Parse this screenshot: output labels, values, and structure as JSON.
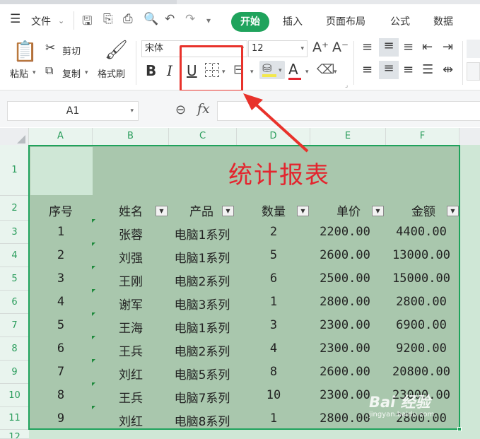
{
  "menubar": {
    "file_label": "文件",
    "kaishi_label": "开始",
    "tabs": [
      "插入",
      "页面布局",
      "公式",
      "数据"
    ]
  },
  "ribbon": {
    "paste_label": "粘贴",
    "cut_label": "剪切",
    "copy_label": "复制",
    "format_painter_label": "格式刷",
    "font_name": "宋体",
    "font_size": "12",
    "bold_label": "B",
    "italic_label": "I",
    "underline_label": "U",
    "font_color_label": "A",
    "increase_font_label": "A⁺",
    "decrease_font_label": "A⁻",
    "font_color_hex": "#e3252e",
    "highlight_color_hex": "#f3e84a"
  },
  "formula": {
    "cell_ref": "A1",
    "fx_label": "fx",
    "value": ""
  },
  "columns": [
    "A",
    "B",
    "C",
    "D",
    "E",
    "F"
  ],
  "rows": [
    "1",
    "2",
    "3",
    "4",
    "5",
    "6",
    "7",
    "8",
    "9",
    "10",
    "11",
    "12"
  ],
  "sheet": {
    "title": "统计报表",
    "headers": [
      "序号",
      "姓名",
      "产品",
      "数量",
      "单价",
      "金额"
    ],
    "data": [
      [
        "1",
        "张蓉",
        "电脑1系列",
        "2",
        "2200.00",
        "4400.00"
      ],
      [
        "2",
        "刘强",
        "电脑1系列",
        "5",
        "2600.00",
        "13000.00"
      ],
      [
        "3",
        "王刚",
        "电脑2系列",
        "6",
        "2500.00",
        "15000.00"
      ],
      [
        "4",
        "谢军",
        "电脑3系列",
        "1",
        "2800.00",
        "2800.00"
      ],
      [
        "5",
        "王海",
        "电脑1系列",
        "3",
        "2300.00",
        "6900.00"
      ],
      [
        "6",
        "王兵",
        "电脑2系列",
        "4",
        "2300.00",
        "9200.00"
      ],
      [
        "7",
        "刘红",
        "电脑5系列",
        "8",
        "2600.00",
        "20800.00"
      ],
      [
        "8",
        "王兵",
        "电脑7系列",
        "10",
        "2300.00",
        "23000.00"
      ],
      [
        "9",
        "刘红",
        "电脑8系列",
        "1",
        "2800.00",
        "2800.00"
      ]
    ],
    "fill_color": "#a9c7ad",
    "selection_color": "#1fa35c"
  },
  "watermark": {
    "text": "Bai 经验",
    "url_text": "jingyan.baidu.com"
  },
  "annotation": {
    "color": "#e8322b"
  }
}
